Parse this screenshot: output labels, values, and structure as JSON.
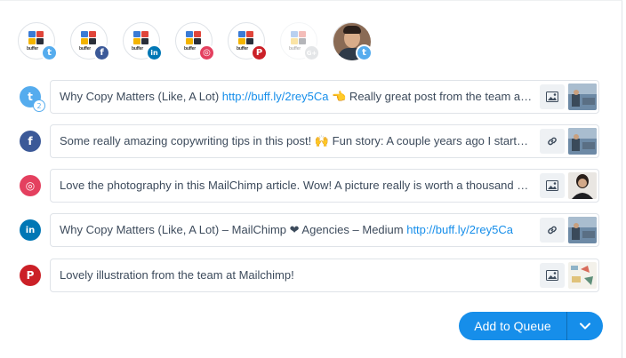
{
  "profiles": [
    {
      "name": "buffer-twitter",
      "network": "twitter",
      "logo_word": "buffer",
      "badge": "t",
      "color": "#55acee"
    },
    {
      "name": "buffer-facebook",
      "network": "facebook",
      "logo_word": "buffer",
      "badge": "f",
      "color": "#3b5998"
    },
    {
      "name": "buffer-linkedin",
      "network": "linkedin",
      "logo_word": "buffer",
      "badge": "in",
      "color": "#0077b5"
    },
    {
      "name": "buffer-instagram",
      "network": "instagram",
      "logo_word": "buffer",
      "badge": "◎",
      "color": "#e4405f"
    },
    {
      "name": "buffer-pinterest",
      "network": "pinterest",
      "logo_word": "buffer",
      "badge": "P",
      "color": "#cb2027"
    },
    {
      "name": "buffer-googleplus",
      "network": "google-plus",
      "logo_word": "buffer",
      "badge": "G+",
      "color": "#b5b9bf"
    },
    {
      "name": "personal-twitter",
      "network": "twitter",
      "badge": "t",
      "color": "#55acee"
    }
  ],
  "posts": [
    {
      "network": "twitter",
      "icon": "t",
      "count": "2",
      "text": "Why Copy Matters (Like, A Lot) ",
      "link": "http://buff.ly/2rey5Ca",
      "text_after": " 👈 Really great post from the team at MailChimp about why copy matters",
      "attachment": "image-icon",
      "thumb": "blue"
    },
    {
      "network": "facebook",
      "icon": "f",
      "text": "Some really amazing copywriting tips in this post! 🙌 Fun story: A couple years ago I started my career",
      "link": "",
      "text_after": "",
      "attachment": "link-icon",
      "thumb": "blue"
    },
    {
      "network": "instagram",
      "icon": "◎",
      "text": "Love the photography in this MailChimp article. Wow! A picture really is worth a thousand words",
      "link": "",
      "text_after": "",
      "attachment": "image-icon",
      "thumb": "person"
    },
    {
      "network": "linkedin",
      "icon": "in",
      "text": "Why Copy Matters (Like, A Lot) – MailChimp ❤ Agencies – Medium ",
      "link": "http://buff.ly/2rey5Ca",
      "text_after": "",
      "attachment": "link-icon",
      "thumb": "blue"
    },
    {
      "network": "pinterest",
      "icon": "P",
      "text": "Lovely illustration from the team at Mailchimp!",
      "link": "",
      "text_after": "",
      "attachment": "image-icon",
      "thumb": "illustration"
    }
  ],
  "queue": {
    "label": "Add to Queue",
    "caret": "chevron-down-icon"
  },
  "colors": {
    "accent": "#168eea",
    "link": "#168eea",
    "text": "#3d4b5c",
    "border": "#dfe3e8"
  }
}
